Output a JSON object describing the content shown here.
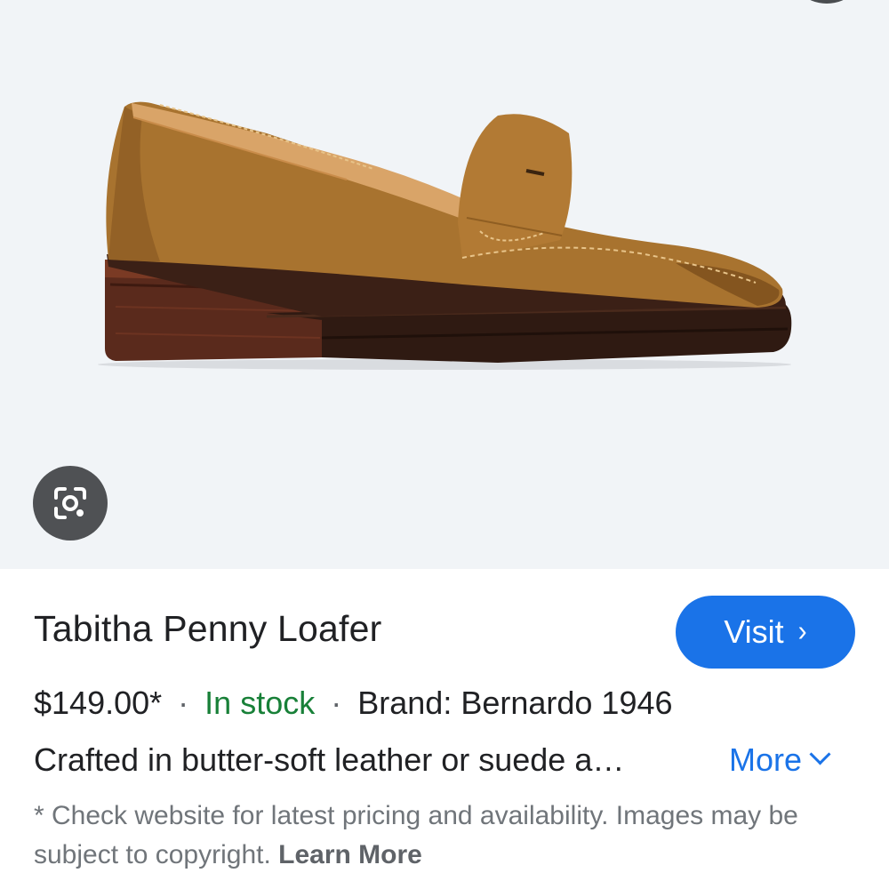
{
  "product": {
    "title": "Tabitha Penny Loafer",
    "price": "$149.00*",
    "stock": "In stock",
    "brand": "Brand: Bernardo 1946",
    "description": "Crafted in butter-soft leather or suede a…",
    "separator": "·"
  },
  "actions": {
    "visit_label": "Visit",
    "visit_chevron": "›",
    "more_label": "More"
  },
  "disclaimer": {
    "text": "* Check website for latest pricing and availability. Images may be subject to copyright.",
    "learn_more": "Learn More"
  },
  "icons": {
    "lens": "google-lens-icon",
    "visit_chevron": "chevron-right-icon",
    "more_chevron": "chevron-down-icon"
  },
  "colors": {
    "accent": "#1a73e8",
    "in_stock": "#188038",
    "image_background": "#f1f4f7",
    "lens_button": "#4f5154"
  }
}
